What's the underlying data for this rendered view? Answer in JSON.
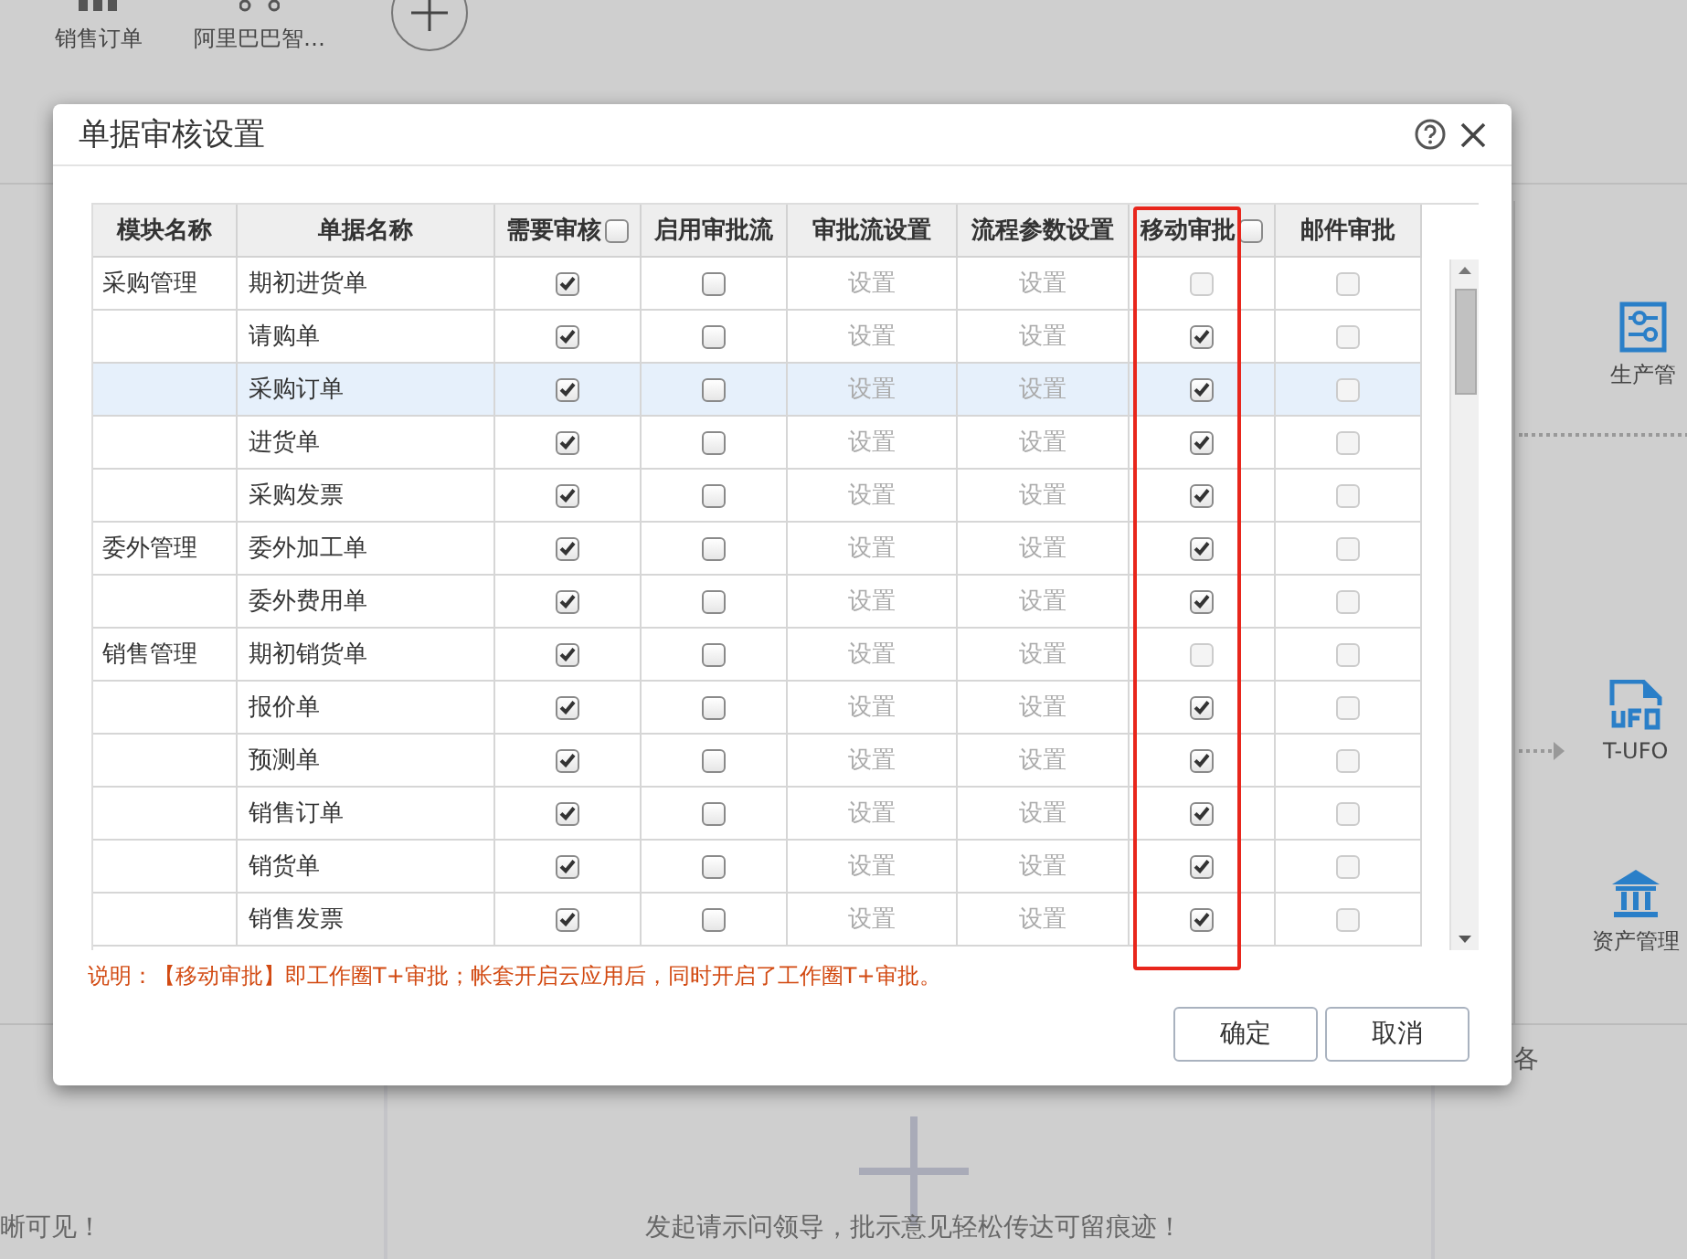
{
  "background": {
    "shortcuts": [
      {
        "label": "销售订单",
        "kind": "grid"
      },
      {
        "label": "阿里巴巴智…",
        "kind": "dots"
      }
    ],
    "side_items": [
      {
        "label": "生产管",
        "kind": "sliders"
      },
      {
        "label": "T-UFO",
        "kind": "ufo"
      },
      {
        "label": "资产管理",
        "kind": "bank"
      }
    ],
    "footer_texts": [
      "晰可见！",
      "发起请示问领导，批示意见轻松传达可留痕迹！"
    ],
    "edge_text": "各"
  },
  "dialog": {
    "title": "单据审核设置",
    "columns": [
      {
        "label": "模块名称",
        "highlighted": false
      },
      {
        "label": "单据名称",
        "highlighted": false
      },
      {
        "label": "需要审核",
        "checked": false,
        "highlighted": false
      },
      {
        "label": "启用审批流",
        "highlighted": false
      },
      {
        "label": "审批流设置",
        "highlighted": false
      },
      {
        "label": "流程参数设置",
        "highlighted": false
      },
      {
        "label": "移动审批",
        "checked": false,
        "highlighted": true
      },
      {
        "label": "邮件审批",
        "highlighted": false
      }
    ],
    "rows": [
      {
        "module": "采购管理",
        "name": "期初进货单",
        "selected": false,
        "audit": {
          "checked": true,
          "disabled": false
        },
        "flow": {
          "checked": false,
          "disabled": false
        },
        "flow_setting": {
          "text": "设置",
          "disabled": true
        },
        "param_setting": {
          "text": "设置",
          "disabled": true
        },
        "mobile": {
          "checked": false,
          "disabled": true
        },
        "mail": {
          "checked": false,
          "disabled": true
        }
      },
      {
        "name": "请购单",
        "selected": false,
        "audit": {
          "checked": true,
          "disabled": false
        },
        "flow": {
          "checked": false,
          "disabled": false
        },
        "flow_setting": {
          "text": "设置",
          "disabled": true
        },
        "param_setting": {
          "text": "设置",
          "disabled": true
        },
        "mobile": {
          "checked": true,
          "disabled": false
        },
        "mail": {
          "checked": false,
          "disabled": true
        }
      },
      {
        "name": "采购订单",
        "selected": true,
        "audit": {
          "checked": true,
          "disabled": false
        },
        "flow": {
          "checked": false,
          "disabled": false
        },
        "flow_setting": {
          "text": "设置",
          "disabled": true
        },
        "param_setting": {
          "text": "设置",
          "disabled": true
        },
        "mobile": {
          "checked": true,
          "disabled": false
        },
        "mail": {
          "checked": false,
          "disabled": true
        }
      },
      {
        "name": "进货单",
        "selected": false,
        "audit": {
          "checked": true,
          "disabled": false
        },
        "flow": {
          "checked": false,
          "disabled": false
        },
        "flow_setting": {
          "text": "设置",
          "disabled": true
        },
        "param_setting": {
          "text": "设置",
          "disabled": true
        },
        "mobile": {
          "checked": true,
          "disabled": false
        },
        "mail": {
          "checked": false,
          "disabled": true
        }
      },
      {
        "name": "采购发票",
        "selected": false,
        "audit": {
          "checked": true,
          "disabled": false
        },
        "flow": {
          "checked": false,
          "disabled": false
        },
        "flow_setting": {
          "text": "设置",
          "disabled": true
        },
        "param_setting": {
          "text": "设置",
          "disabled": true
        },
        "mobile": {
          "checked": true,
          "disabled": false
        },
        "mail": {
          "checked": false,
          "disabled": true
        }
      },
      {
        "module": "委外管理",
        "name": "委外加工单",
        "selected": false,
        "audit": {
          "checked": true,
          "disabled": false
        },
        "flow": {
          "checked": false,
          "disabled": false
        },
        "flow_setting": {
          "text": "设置",
          "disabled": true
        },
        "param_setting": {
          "text": "设置",
          "disabled": true
        },
        "mobile": {
          "checked": true,
          "disabled": false
        },
        "mail": {
          "checked": false,
          "disabled": true
        }
      },
      {
        "name": "委外费用单",
        "selected": false,
        "audit": {
          "checked": true,
          "disabled": false
        },
        "flow": {
          "checked": false,
          "disabled": false
        },
        "flow_setting": {
          "text": "设置",
          "disabled": true
        },
        "param_setting": {
          "text": "设置",
          "disabled": true
        },
        "mobile": {
          "checked": true,
          "disabled": false
        },
        "mail": {
          "checked": false,
          "disabled": true
        }
      },
      {
        "module": "销售管理",
        "name": "期初销货单",
        "selected": false,
        "audit": {
          "checked": true,
          "disabled": false
        },
        "flow": {
          "checked": false,
          "disabled": false
        },
        "flow_setting": {
          "text": "设置",
          "disabled": true
        },
        "param_setting": {
          "text": "设置",
          "disabled": true
        },
        "mobile": {
          "checked": false,
          "disabled": true
        },
        "mail": {
          "checked": false,
          "disabled": true
        }
      },
      {
        "name": "报价单",
        "selected": false,
        "audit": {
          "checked": true,
          "disabled": false
        },
        "flow": {
          "checked": false,
          "disabled": false
        },
        "flow_setting": {
          "text": "设置",
          "disabled": true
        },
        "param_setting": {
          "text": "设置",
          "disabled": true
        },
        "mobile": {
          "checked": true,
          "disabled": false
        },
        "mail": {
          "checked": false,
          "disabled": true
        }
      },
      {
        "name": "预测单",
        "selected": false,
        "audit": {
          "checked": true,
          "disabled": false
        },
        "flow": {
          "checked": false,
          "disabled": false
        },
        "flow_setting": {
          "text": "设置",
          "disabled": true
        },
        "param_setting": {
          "text": "设置",
          "disabled": true
        },
        "mobile": {
          "checked": true,
          "disabled": false
        },
        "mail": {
          "checked": false,
          "disabled": true
        }
      },
      {
        "name": "销售订单",
        "selected": false,
        "audit": {
          "checked": true,
          "disabled": false
        },
        "flow": {
          "checked": false,
          "disabled": false
        },
        "flow_setting": {
          "text": "设置",
          "disabled": true
        },
        "param_setting": {
          "text": "设置",
          "disabled": true
        },
        "mobile": {
          "checked": true,
          "disabled": false
        },
        "mail": {
          "checked": false,
          "disabled": true
        }
      },
      {
        "name": "销货单",
        "selected": false,
        "audit": {
          "checked": true,
          "disabled": false
        },
        "flow": {
          "checked": false,
          "disabled": false
        },
        "flow_setting": {
          "text": "设置",
          "disabled": true
        },
        "param_setting": {
          "text": "设置",
          "disabled": true
        },
        "mobile": {
          "checked": true,
          "disabled": false
        },
        "mail": {
          "checked": false,
          "disabled": true
        }
      },
      {
        "name": "销售发票",
        "selected": false,
        "audit": {
          "checked": true,
          "disabled": false
        },
        "flow": {
          "checked": false,
          "disabled": false
        },
        "flow_setting": {
          "text": "设置",
          "disabled": true
        },
        "param_setting": {
          "text": "设置",
          "disabled": true
        },
        "mobile": {
          "checked": true,
          "disabled": false
        },
        "mail": {
          "checked": false,
          "disabled": true
        }
      }
    ],
    "note": "说明：【移动审批】即工作圈T+审批；帐套开启云应用后，同时开启了工作圈T+审批。",
    "buttons": [
      "确定",
      "取消"
    ]
  }
}
